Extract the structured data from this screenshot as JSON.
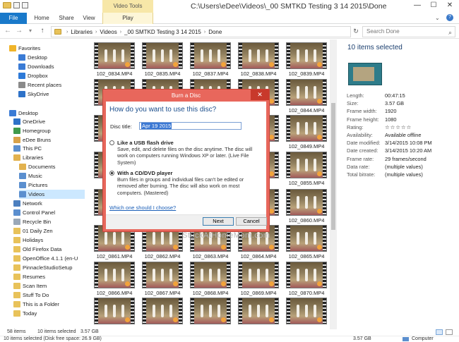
{
  "window": {
    "context_tab_group": "Video Tools",
    "title": "C:\\Users\\eDee\\Videos\\_00 SMTKD Testing 3 14 2015\\Done",
    "minimize": "—",
    "maximize": "☐",
    "close": "✕"
  },
  "ribbon": {
    "tabs": [
      "File",
      "Home",
      "Share",
      "View",
      "Play"
    ]
  },
  "address": {
    "back": "←",
    "forward": "→",
    "dropdown": "▾",
    "up": "↑",
    "crumbs": [
      "Libraries",
      "Videos",
      "_00 SMTKD Testing 3 14 2015",
      "Done"
    ],
    "refresh": "↻",
    "search_placeholder": "Search Done"
  },
  "nav": {
    "items": [
      {
        "label": "Favorites",
        "icon": "star-icon",
        "color": "#f0b429"
      },
      {
        "label": "Desktop",
        "icon": "desktop-icon",
        "color": "#3a7bd5"
      },
      {
        "label": "Downloads",
        "icon": "download-icon",
        "color": "#3a7bd5"
      },
      {
        "label": "Dropbox",
        "icon": "dropbox-icon",
        "color": "#2d7ad8"
      },
      {
        "label": "Recent places",
        "icon": "recent-icon",
        "color": "#8a8a8a"
      },
      {
        "label": "SkyDrive",
        "icon": "cloud-icon",
        "color": "#2e72c8"
      },
      {
        "label": "Desktop",
        "icon": "desktop-icon",
        "color": "#3a7bd5"
      },
      {
        "label": "OneDrive",
        "icon": "cloud-icon",
        "color": "#2e72c8"
      },
      {
        "label": "Homegroup",
        "icon": "homegroup-icon",
        "color": "#3f9a4c"
      },
      {
        "label": "eDee Bruns",
        "icon": "user-icon",
        "color": "#d8a24a"
      },
      {
        "label": "This PC",
        "icon": "computer-icon",
        "color": "#5b8fcf"
      },
      {
        "label": "Libraries",
        "icon": "library-icon",
        "color": "#e2b24f"
      },
      {
        "label": "Documents",
        "icon": "documents-icon",
        "color": "#e2b24f"
      },
      {
        "label": "Music",
        "icon": "music-icon",
        "color": "#5b8fcf"
      },
      {
        "label": "Pictures",
        "icon": "pictures-icon",
        "color": "#5b8fcf"
      },
      {
        "label": "Videos",
        "icon": "videos-icon",
        "color": "#5b8fcf"
      },
      {
        "label": "Network",
        "icon": "network-icon",
        "color": "#4c7fbf"
      },
      {
        "label": "Control Panel",
        "icon": "control-panel-icon",
        "color": "#5b8fcf"
      },
      {
        "label": "Recycle Bin",
        "icon": "recycle-bin-icon",
        "color": "#9aa8b8"
      },
      {
        "label": "01 Daily Zen",
        "icon": "folder-icon",
        "color": "#e8c25a"
      },
      {
        "label": "Holidays",
        "icon": "folder-icon",
        "color": "#e8c25a"
      },
      {
        "label": "Old Firefox Data",
        "icon": "folder-icon",
        "color": "#e8c25a"
      },
      {
        "label": "OpenOffice 4.1.1 (en-U",
        "icon": "folder-icon",
        "color": "#e8c25a"
      },
      {
        "label": "PinnacleStudioSetup",
        "icon": "folder-icon",
        "color": "#e8c25a"
      },
      {
        "label": "Resumes",
        "icon": "folder-icon",
        "color": "#e8c25a"
      },
      {
        "label": "Scan Item",
        "icon": "folder-icon",
        "color": "#e8c25a"
      },
      {
        "label": "Stuff To Do",
        "icon": "folder-icon",
        "color": "#e8c25a"
      },
      {
        "label": "This is a Folder",
        "icon": "folder-icon",
        "color": "#e8c25a"
      },
      {
        "label": "Today",
        "icon": "folder-icon",
        "color": "#e8c25a"
      }
    ]
  },
  "files": {
    "rows": [
      [
        "102_0834.MP4",
        "102_0835.MP4",
        "102_0837.MP4",
        "102_0838.MP4",
        "102_0839.MP4"
      ],
      [
        "",
        "",
        "",
        "",
        "102_0844.MP4"
      ],
      [
        "",
        "",
        "",
        "",
        "102_0849.MP4"
      ],
      [
        "",
        "",
        "",
        "",
        "102_0855.MP4"
      ],
      [
        "",
        "",
        "",
        "",
        "102_0860.MP4"
      ],
      [
        "102_0861.MP4",
        "102_0862.MP4",
        "102_0863.MP4",
        "102_0864.MP4",
        "102_0865.MP4"
      ],
      [
        "102_0866.MP4",
        "102_0867.MP4",
        "102_0868.MP4",
        "102_0869.MP4",
        "102_0870.MP4"
      ],
      [
        "",
        "",
        "",
        "",
        ""
      ]
    ]
  },
  "details": {
    "title": "10 items selected",
    "props": [
      {
        "k": "Length:",
        "v": "00:47:15"
      },
      {
        "k": "Size:",
        "v": "3.57 GB"
      },
      {
        "k": "Frame width:",
        "v": "1920"
      },
      {
        "k": "Frame height:",
        "v": "1080"
      },
      {
        "k": "Rating:",
        "v": "☆☆☆☆☆"
      },
      {
        "k": "Availability:",
        "v": "Available offline"
      },
      {
        "k": "Date modified:",
        "v": "3/14/2015 10:08 PM"
      },
      {
        "k": "Date created:",
        "v": "3/14/2015 10:20 AM"
      },
      {
        "k": "Frame rate:",
        "v": "29 frames/second"
      },
      {
        "k": "Data rate:",
        "v": "(multiple values)"
      },
      {
        "k": "Total bitrate:",
        "v": "(multiple values)"
      }
    ]
  },
  "status": {
    "count": "58 items",
    "selected": "10 items selected",
    "size": "3.57 GB",
    "line2_left": "10 items selected (Disk free space: 26.9 GB)",
    "line2_size": "3.57 GB",
    "location": "Computer"
  },
  "dialog": {
    "title": "Burn a Disc",
    "close": "✕",
    "heading": "How do you want to use this disc?",
    "disc_label": "Disc title:",
    "disc_value": "Apr 19 2015",
    "option1_title": "Like a USB flash drive",
    "option1_desc": "Save, edit, and delete files on the disc anytime. The disc will work on computers running Windows XP or later. (Live File System)",
    "option2_title": "With a CD/DVD player",
    "option2_desc": "Burn files in groups and individual files can't be edited or removed after burning. The disc will also work on most computers. (Mastered)",
    "help": "Which one should I choose?",
    "next": "Next",
    "cancel": "Cancel"
  },
  "watermark": "StuckAtHomeMom.com"
}
